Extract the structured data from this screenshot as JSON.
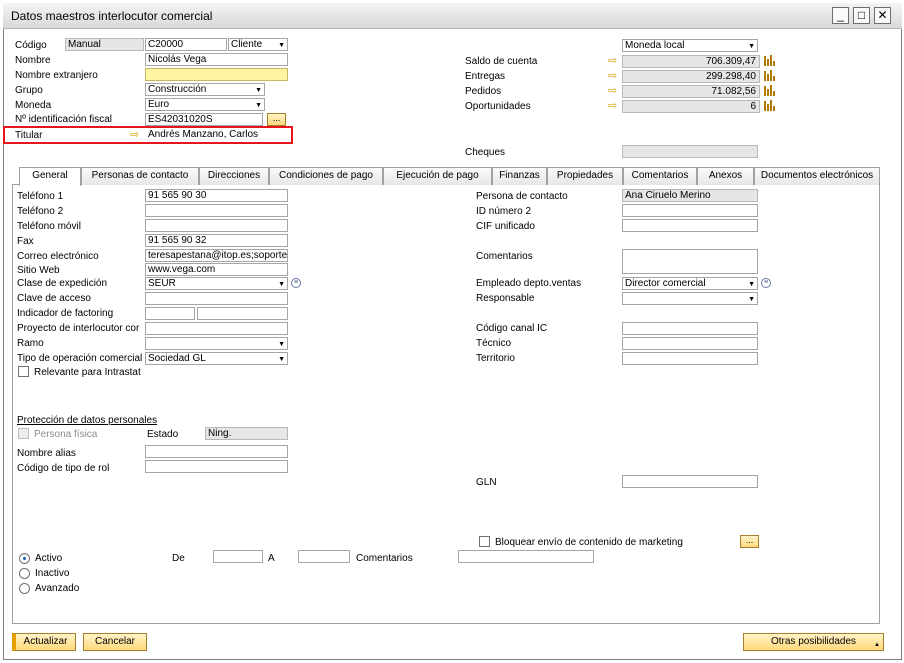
{
  "window": {
    "title": "Datos maestros interlocutor comercial"
  },
  "header": {
    "codigo_label": "Código",
    "codigo_series": "Manual",
    "codigo_value": "C20000",
    "codigo_type": "Cliente",
    "nombre_label": "Nombre",
    "nombre_value": "Nicolás Vega",
    "nombre_extranjero_label": "Nombre extranjero",
    "grupo_label": "Grupo",
    "grupo_value": "Construcción",
    "moneda_label": "Moneda",
    "moneda_value": "Euro",
    "nif_label": "Nº identificación fiscal",
    "nif_value": "ES42031020S",
    "nif_button": "...",
    "titular_label": "Titular",
    "titular_value": "Andrés Manzano, Carlos",
    "currency_mode": "Moneda local",
    "saldo_label": "Saldo de cuenta",
    "saldo_value": "706.309,47",
    "entregas_label": "Entregas",
    "entregas_value": "299.298,40",
    "pedidos_label": "Pedidos",
    "pedidos_value": "71.082,56",
    "oportunidades_label": "Oportunidades",
    "oportunidades_value": "6",
    "cheques_label": "Cheques"
  },
  "tabs": [
    {
      "label": "General"
    },
    {
      "label": "Personas de contacto"
    },
    {
      "label": "Direcciones"
    },
    {
      "label": "Condiciones de pago"
    },
    {
      "label": "Ejecución de pago"
    },
    {
      "label": "Finanzas"
    },
    {
      "label": "Propiedades"
    },
    {
      "label": "Comentarios"
    },
    {
      "label": "Anexos"
    },
    {
      "label": "Documentos electrónicos"
    }
  ],
  "general": {
    "telefono1_label": "Teléfono 1",
    "telefono1_value": "91 565 90 30",
    "telefono2_label": "Teléfono 2",
    "telefono_movil_label": "Teléfono móvil",
    "fax_label": "Fax",
    "fax_value": "91 565 90 32",
    "correo_label": "Correo electrónico",
    "correo_value": "teresapestana@itop.es;soporte@",
    "sitio_label": "Sitio Web",
    "sitio_value": "www.vega.com",
    "clase_exp_label": "Clase de expedición",
    "clase_exp_value": "SEUR",
    "clave_label": "Clave de acceso",
    "factoring_label": "Indicador de factoring",
    "proyecto_label": "Proyecto de interlocutor cor",
    "ramo_label": "Ramo",
    "tipo_op_label": "Tipo de operación comercial",
    "tipo_op_value": "Sociedad GL",
    "intrastat_label": "Relevante para Intrastat",
    "proteccion_label": "Protección de datos personales",
    "persona_fisica_label": "Persona física",
    "estado_label": "Estado",
    "estado_value": "Ning.",
    "nombre_alias_label": "Nombre alias",
    "codigo_rol_label": "Código de tipo de rol",
    "persona_contacto_label": "Persona de contacto",
    "persona_contacto_value": "Ana Ciruelo Merino",
    "id2_label": "ID número 2",
    "cif_label": "CIF unificado",
    "comentarios_label": "Comentarios",
    "empleado_label": "Empleado depto.ventas",
    "empleado_value": "Director comercial",
    "responsable_label": "Responsable",
    "canal_label": "Código canal IC",
    "tecnico_label": "Técnico",
    "territorio_label": "Territorio",
    "gln_label": "GLN",
    "bloquear_label": "Bloquear envío de contenido de marketing",
    "bloquear_button": "...",
    "activo_label": "Activo",
    "inactivo_label": "Inactivo",
    "avanzado_label": "Avanzado",
    "de_label": "De",
    "a_label": "A",
    "comentarios2_label": "Comentarios"
  },
  "footer": {
    "actualizar": "Actualizar",
    "cancelar": "Cancelar",
    "otras": "Otras posibilidades"
  }
}
